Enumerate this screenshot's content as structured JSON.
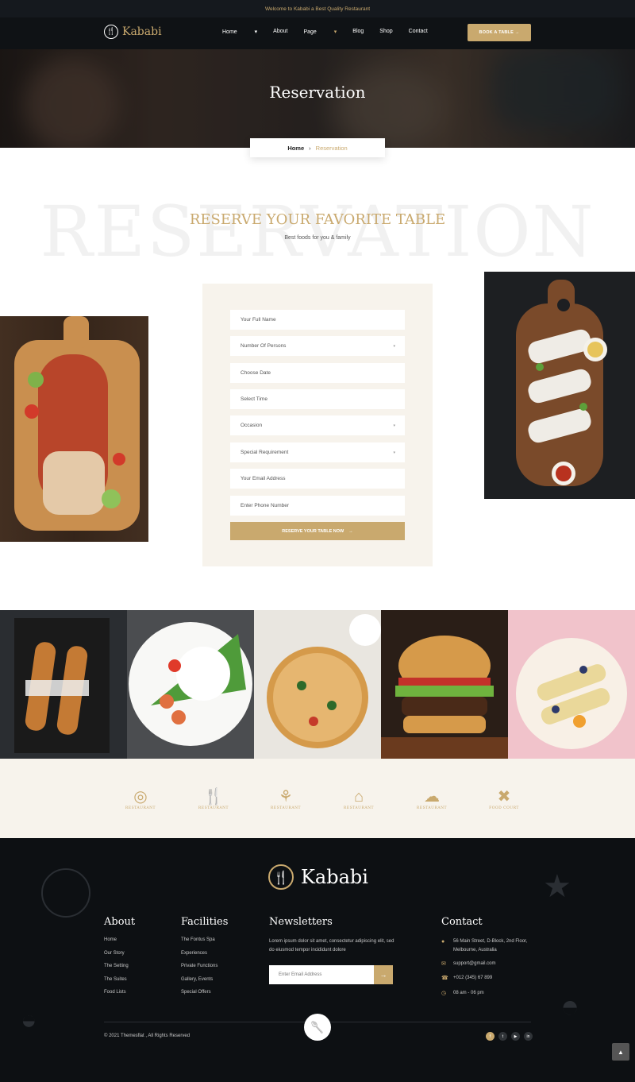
{
  "topbar": {
    "text": "Welcome to Kababi a Best Quality Restaurant"
  },
  "brand": {
    "name": "Kababi"
  },
  "nav": {
    "items": [
      "Home",
      "About",
      "Page",
      "Blog",
      "Shop",
      "Contact"
    ],
    "active": "Page",
    "book_label": "BOOK A TABLE"
  },
  "hero": {
    "title": "Reservation"
  },
  "breadcrumb": {
    "home": "Home",
    "current": "Reservation"
  },
  "section": {
    "watermark": "RESERVATION",
    "title": "RESERVE YOUR FAVORITE TABLE",
    "subtitle": "Best foods for you & family"
  },
  "form": {
    "fields": [
      {
        "placeholder": "Your Full Name",
        "select": false
      },
      {
        "placeholder": "Number Of Persons",
        "select": true
      },
      {
        "placeholder": "Choose Date",
        "select": false
      },
      {
        "placeholder": "Select Time",
        "select": false
      },
      {
        "placeholder": "Occasion",
        "select": true
      },
      {
        "placeholder": "Special Requirement",
        "select": true
      },
      {
        "placeholder": "Your Email Address",
        "select": false
      },
      {
        "placeholder": "Enter Phone Number",
        "select": false
      }
    ],
    "submit_label": "RESERVE YOUR TABLE NOW"
  },
  "partner_logos": [
    {
      "icon": "restaurant-badge-icon",
      "text": "RESTAURANT"
    },
    {
      "icon": "cutlery-icon",
      "text": "RESTAURANT"
    },
    {
      "icon": "plate-icon",
      "text": "RESTAURANT"
    },
    {
      "icon": "cloche-icon",
      "text": "RESTAURANT"
    },
    {
      "icon": "chef-hat-icon",
      "text": "RESTAURANT"
    },
    {
      "icon": "food-court-icon",
      "text": "FOOD COURT"
    }
  ],
  "footer": {
    "about": {
      "title": "About",
      "links": [
        "Home",
        "Our Story",
        "The Setting",
        "The Suites",
        "Food Lists"
      ]
    },
    "facilities": {
      "title": "Facilities",
      "links": [
        "The Fontus Spa",
        "Experiences",
        "Private Functions",
        "Gallery, Events",
        "Special Offers"
      ]
    },
    "newsletter": {
      "title": "Newsletters",
      "text": "Lorem ipsum dolor sit amet, consectetur adipiscing elit, sed do eiusmod tempor incididunt dolore",
      "placeholder": "Enter Email Address"
    },
    "contact": {
      "title": "Contact",
      "address": "56 Main Street, D-Block, 2nd Floor, Melbourne, Australia",
      "email": "support@gmail.com",
      "phone": "+012 (345) 67 899",
      "hours": "08 am - 06 pm"
    },
    "copyright": "© 2021 Themesflat , All Rights Reserved"
  },
  "colors": {
    "accent": "#c9a96e",
    "dark": "#0d1013",
    "cream": "#f7f3ec"
  }
}
